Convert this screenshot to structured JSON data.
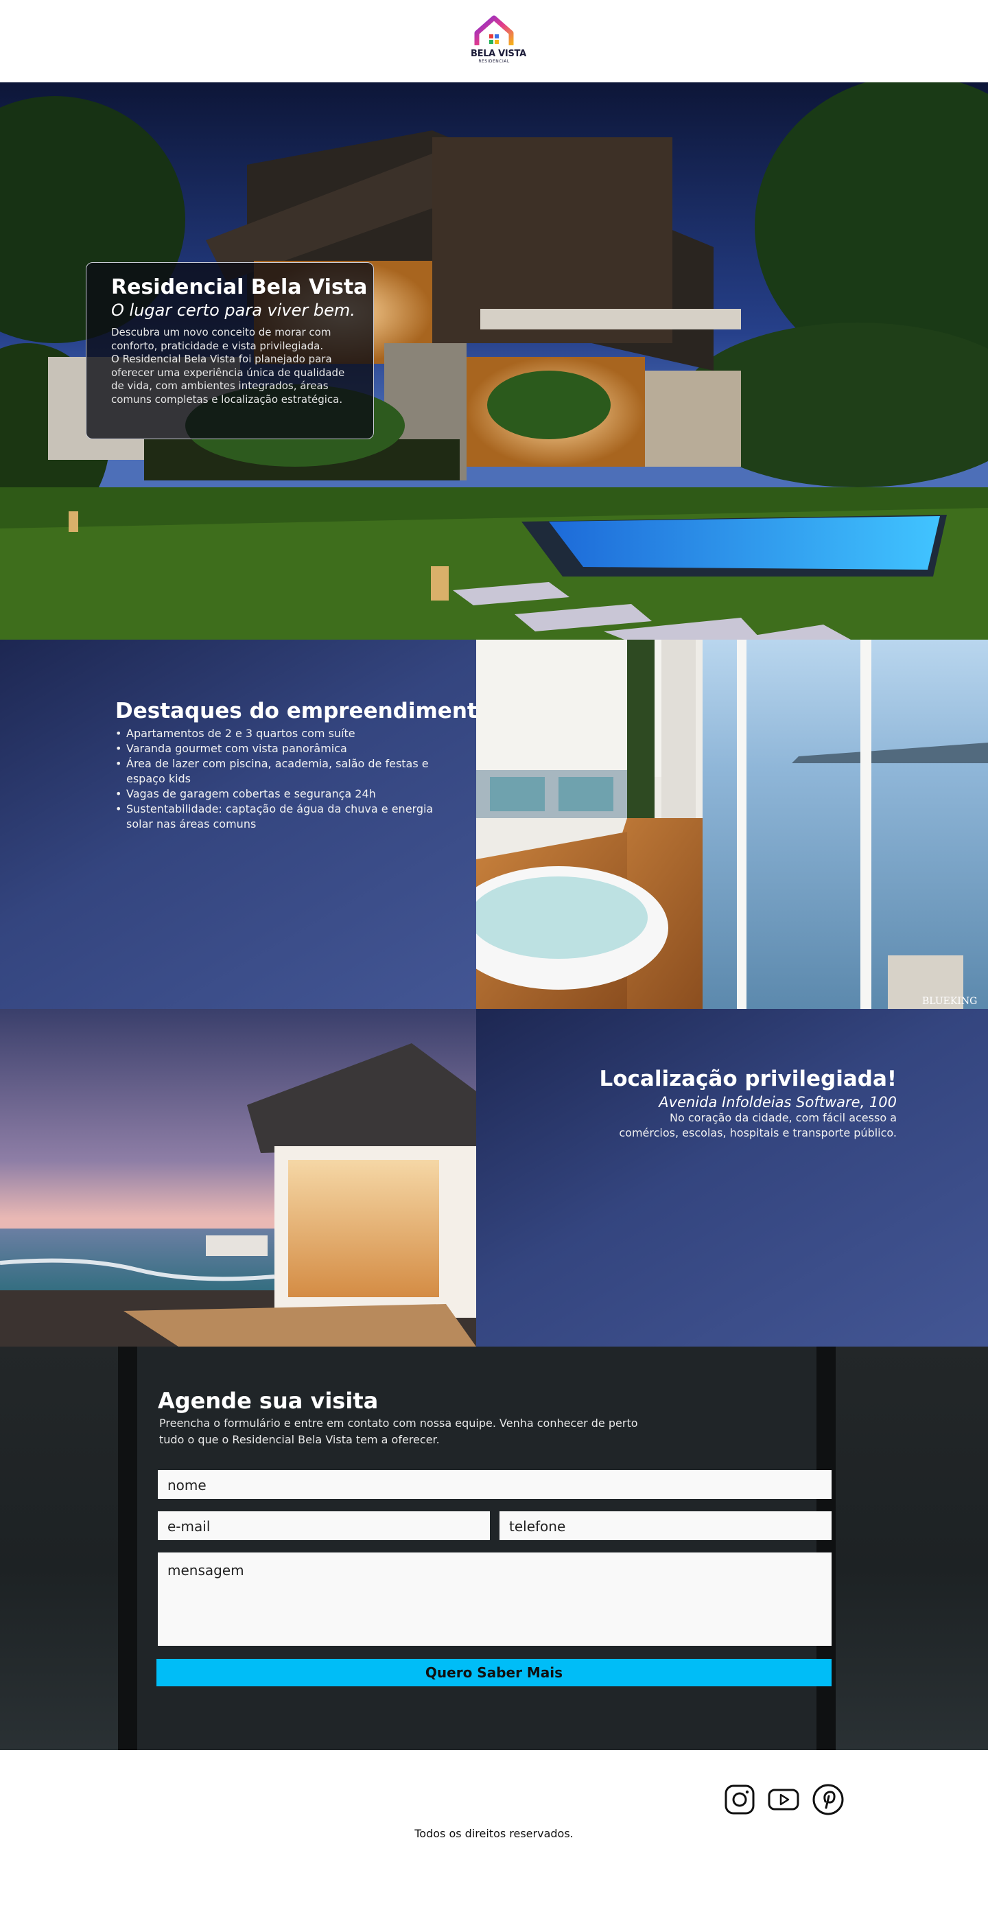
{
  "header": {
    "logo_name": "BELA VISTA",
    "logo_sub": "RESIDENCIAL"
  },
  "hero": {
    "title": "Residencial Bela Vista",
    "subtitle": "O lugar certo para viver bem.",
    "text": "Descubra um novo conceito de morar com conforto, praticidade e vista privilegiada.\n O Residencial Bela Vista foi planejado para oferecer uma experiência única de qualidade de vida, com ambientes integrados, áreas comuns completas e localização estratégica."
  },
  "features": {
    "title": "Destaques do empreendimento",
    "items": [
      "Apartamentos de 2 e 3 quartos com suíte",
      "Varanda gourmet com vista panorâmica",
      "Área de lazer com piscina, academia, salão de festas e espaço kids",
      "Vagas de garagem cobertas e segurança 24h",
      "Sustentabilidade: captação de água da chuva e energia solar nas áreas comuns"
    ]
  },
  "interior_image": {
    "watermark": "BLUEKING"
  },
  "location": {
    "title": "Localização privilegiada!",
    "address": "Avenida Infoldeias Software, 100",
    "text": "No coração da cidade, com fácil acesso a comércios, escolas, hospitais e transporte público."
  },
  "contact": {
    "title": "Agende sua visita",
    "text": "Preencha o formulário e entre em contato com nossa equipe. Venha conhecer de perto tudo o que o Residencial Bela Vista tem a oferecer.",
    "name_placeholder": "nome",
    "email_placeholder": "e-mail",
    "phone_placeholder": "telefone",
    "message_placeholder": "mensagem",
    "submit_label": "Quero Saber Mais",
    "submit_color": "#00bdf7"
  },
  "footer": {
    "social_icons": [
      "instagram-icon",
      "youtube-icon",
      "pinterest-icon"
    ],
    "copyright": "Todos os direitos reservados."
  }
}
